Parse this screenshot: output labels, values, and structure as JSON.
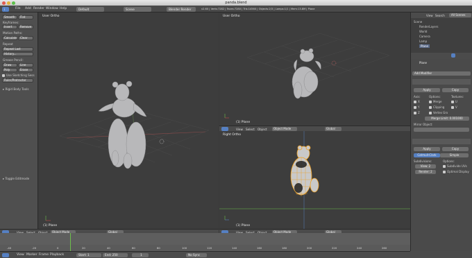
{
  "window": {
    "title": "panda.blend"
  },
  "topbar": {
    "menus": [
      "File",
      "Add",
      "Render",
      "Window",
      "Help"
    ],
    "layout": "Default",
    "scene": "Scene",
    "engine": "Blender Render",
    "stats": "v2.60 | Verts:7282 | Faces:7280 | Tris:14560 | Objects:2/3 | Lamps:1/1 | Mem:13.8M | Plane"
  },
  "tools": {
    "transform_buttons": [
      "Smooth",
      "Flat"
    ],
    "keyframes_header": "Keyframes:",
    "keyframes_buttons": [
      "Insert",
      "Remove"
    ],
    "motion_header": "Motion Paths:",
    "motion_buttons": [
      "Calculate",
      "Clear"
    ],
    "repeat": "Repeat",
    "repeat_last": "Repeat Last",
    "history": "History...",
    "grease_header": "Grease Pencil:",
    "grease_buttons": [
      "Draw",
      "Line",
      "Poly",
      "Erase"
    ],
    "use_sketching": "Use Sketching Sess",
    "ruler": "Ruler/Protractor",
    "rigid_body": "Rigid Body Tools",
    "toggle_editmode": "Toggle Editmode"
  },
  "viewports": {
    "left": {
      "label": "User Ortho",
      "footer": "(1) Plane"
    },
    "top_right": {
      "label": "User Ortho",
      "footer": "(1) Plane"
    },
    "bottom_right": {
      "label": "Right Ortho",
      "footer": "(1) Plane"
    }
  },
  "view_header": {
    "menus": [
      "View",
      "Select",
      "Object"
    ],
    "mode": "Object Mode",
    "orientation": "Global"
  },
  "outliner": {
    "menus": [
      "View",
      "Search"
    ],
    "scope": "All Scenes",
    "items": [
      "Scene",
      "RenderLayers",
      "World",
      "Camera",
      "Lamp",
      "Plane"
    ]
  },
  "properties": {
    "object_name": "Plane",
    "add_modifier": "Add Modifier",
    "apply": "Apply",
    "copy": "Copy",
    "axis_header": "Axis:",
    "options_header": "Options:",
    "textures_header": "Textures:",
    "axis": [
      "X",
      "Y",
      "Z"
    ],
    "options": [
      "Merge",
      "Clipping",
      "Vertex Gro"
    ],
    "textures": [
      "U",
      "V"
    ],
    "merge_limit": "Merge Limit: 0.001000",
    "mirror_object": "Mirror Object:",
    "catmull": "Catmull-Clark",
    "simple": "Simple",
    "subdivisions_header": "Subdivisions:",
    "sub_options_header": "Options:",
    "view_level": "View: 2",
    "render_level": "Render: 2",
    "subdivide_uvs": "Subdivide UVs",
    "optimal_display": "Optimal Display"
  },
  "timeline": {
    "ticks": [
      "-40",
      "-20",
      "0",
      "20",
      "40",
      "60",
      "80",
      "100",
      "120",
      "140",
      "160",
      "180",
      "200",
      "220",
      "240",
      "260"
    ],
    "menus": [
      "View",
      "Marker",
      "Frame",
      "Playback"
    ],
    "start": "Start: 1",
    "end": "End: 250",
    "current": "1",
    "sync": "No Sync"
  },
  "colors": {
    "accent": "#5680c2",
    "selection": "#f0a020",
    "viewport": "#3d3d3d"
  }
}
